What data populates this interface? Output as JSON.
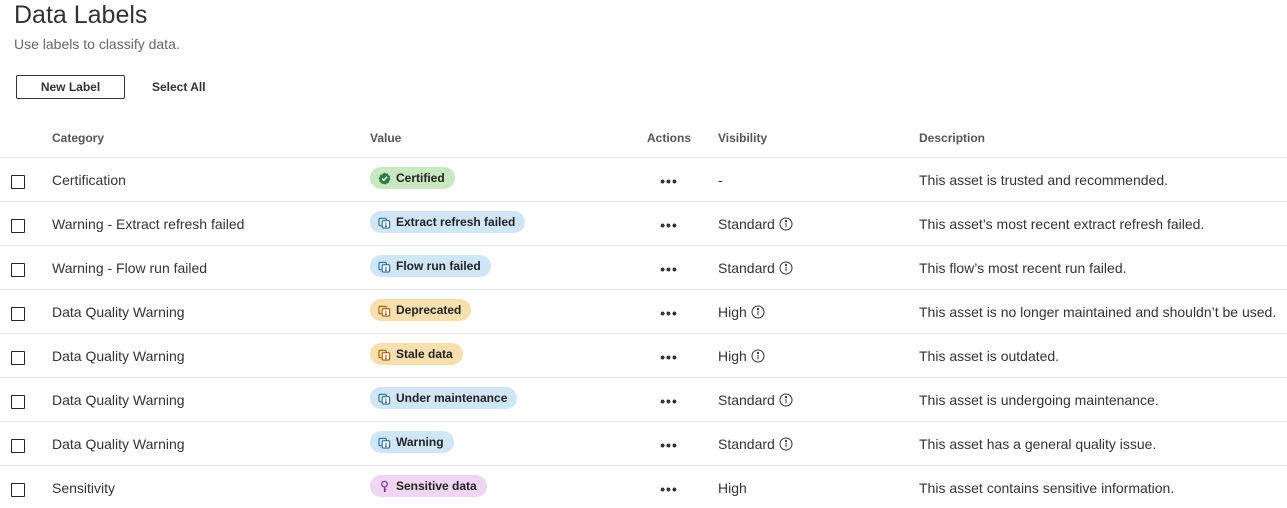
{
  "page": {
    "title": "Data Labels",
    "subtitle": "Use labels to classify data."
  },
  "toolbar": {
    "new_label": "New Label",
    "select_all": "Select All"
  },
  "table": {
    "headers": {
      "category": "Category",
      "value": "Value",
      "actions": "Actions",
      "visibility": "Visibility",
      "description": "Description"
    },
    "actions_glyph": "•••",
    "rows": [
      {
        "category": "Certification",
        "value": "Certified",
        "value_icon": "check-badge-icon",
        "pill_color": "#c8e8c0",
        "icon_color": "#2e7d3e",
        "visibility": "-",
        "visibility_info": false,
        "description": "This asset is trusted and recommended."
      },
      {
        "category": "Warning - Extract refresh failed",
        "value": "Extract refresh failed",
        "value_icon": "warning-stack-icon",
        "pill_color": "#cfe6f7",
        "icon_color": "#2b6a99",
        "visibility": "Standard",
        "visibility_info": true,
        "description": "This asset’s most recent extract refresh failed."
      },
      {
        "category": "Warning - Flow run failed",
        "value": "Flow run failed",
        "value_icon": "warning-stack-icon",
        "pill_color": "#cfe6f7",
        "icon_color": "#2b6a99",
        "visibility": "Standard",
        "visibility_info": true,
        "description": "This flow’s most recent run failed."
      },
      {
        "category": "Data Quality Warning",
        "value": "Deprecated",
        "value_icon": "warning-stack-icon",
        "pill_color": "#f8dfb0",
        "icon_color": "#a85c00",
        "visibility": "High",
        "visibility_info": true,
        "description": "This asset is no longer maintained and shouldn’t be used."
      },
      {
        "category": "Data Quality Warning",
        "value": "Stale data",
        "value_icon": "warning-stack-icon",
        "pill_color": "#f8dfb0",
        "icon_color": "#a85c00",
        "visibility": "High",
        "visibility_info": true,
        "description": "This asset is outdated."
      },
      {
        "category": "Data Quality Warning",
        "value": "Under maintenance",
        "value_icon": "warning-stack-icon",
        "pill_color": "#cfe6f7",
        "icon_color": "#2b6a99",
        "visibility": "Standard",
        "visibility_info": true,
        "description": "This asset is undergoing maintenance."
      },
      {
        "category": "Data Quality Warning",
        "value": "Warning",
        "value_icon": "warning-stack-icon",
        "pill_color": "#cfe6f7",
        "icon_color": "#2b6a99",
        "visibility": "Standard",
        "visibility_info": true,
        "description": "This asset has a general quality issue."
      },
      {
        "category": "Sensitivity",
        "value": "Sensitive data",
        "value_icon": "key-icon",
        "pill_color": "#f0d5f5",
        "icon_color": "#8a2f9c",
        "visibility": "High",
        "visibility_info": false,
        "description": "This asset contains sensitive information."
      }
    ]
  }
}
